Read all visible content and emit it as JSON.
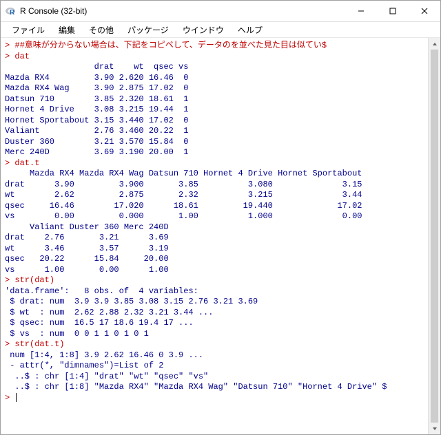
{
  "window": {
    "title": "R Console (32-bit)"
  },
  "menubar": {
    "file": "ファイル",
    "edit": "編集",
    "misc": "その他",
    "packages": "パッケージ",
    "window": "ウインドウ",
    "help": "ヘルプ"
  },
  "console": {
    "line1_prompt": "> ",
    "line1_text": "##意味が分からない場合は、下記をコピペして、データのを並べた見た目は似てい$",
    "line2_prompt": "> ",
    "line2_text": "dat",
    "out_block1": "                  drat    wt  qsec vs\nMazda RX4         3.90 2.620 16.46  0\nMazda RX4 Wag     3.90 2.875 17.02  0\nDatsun 710        3.85 2.320 18.61  1\nHornet 4 Drive    3.08 3.215 19.44  1\nHornet Sportabout 3.15 3.440 17.02  0\nValiant           2.76 3.460 20.22  1\nDuster 360        3.21 3.570 15.84  0\nMerc 240D         3.69 3.190 20.00  1",
    "line3_prompt": "> ",
    "line3_text": "dat.t",
    "out_block2": "     Mazda RX4 Mazda RX4 Wag Datsun 710 Hornet 4 Drive Hornet Sportabout\ndrat      3.90         3.900       3.85          3.080              3.15\nwt        2.62         2.875       2.32          3.215              3.44\nqsec     16.46        17.020      18.61         19.440             17.02\nvs        0.00         0.000       1.00          1.000              0.00\n     Valiant Duster 360 Merc 240D\ndrat    2.76       3.21      3.69\nwt      3.46       3.57      3.19\nqsec   20.22      15.84     20.00\nvs      1.00       0.00      1.00",
    "line4_prompt": "> ",
    "line4_text": "str(dat)",
    "out_block3": "'data.frame':   8 obs. of  4 variables:\n $ drat: num  3.9 3.9 3.85 3.08 3.15 2.76 3.21 3.69\n $ wt  : num  2.62 2.88 2.32 3.21 3.44 ...\n $ qsec: num  16.5 17 18.6 19.4 17 ...\n $ vs  : num  0 0 1 1 0 1 0 1",
    "line5_prompt": "> ",
    "line5_text": "str(dat.t)",
    "out_block4": " num [1:4, 1:8] 3.9 2.62 16.46 0 3.9 ...\n - attr(*, \"dimnames\")=List of 2\n  ..$ : chr [1:4] \"drat\" \"wt\" \"qsec\" \"vs\"\n  ..$ : chr [1:8] \"Mazda RX4\" \"Mazda RX4 Wag\" \"Datsun 710\" \"Hornet 4 Drive\" $",
    "line6_prompt": "> "
  },
  "chart_data": {
    "type": "table",
    "title": "dat",
    "columns": [
      "drat",
      "wt",
      "qsec",
      "vs"
    ],
    "rows": [
      {
        "name": "Mazda RX4",
        "drat": 3.9,
        "wt": 2.62,
        "qsec": 16.46,
        "vs": 0
      },
      {
        "name": "Mazda RX4 Wag",
        "drat": 3.9,
        "wt": 2.875,
        "qsec": 17.02,
        "vs": 0
      },
      {
        "name": "Datsun 710",
        "drat": 3.85,
        "wt": 2.32,
        "qsec": 18.61,
        "vs": 1
      },
      {
        "name": "Hornet 4 Drive",
        "drat": 3.08,
        "wt": 3.215,
        "qsec": 19.44,
        "vs": 1
      },
      {
        "name": "Hornet Sportabout",
        "drat": 3.15,
        "wt": 3.44,
        "qsec": 17.02,
        "vs": 0
      },
      {
        "name": "Valiant",
        "drat": 2.76,
        "wt": 3.46,
        "qsec": 20.22,
        "vs": 1
      },
      {
        "name": "Duster 360",
        "drat": 3.21,
        "wt": 3.57,
        "qsec": 15.84,
        "vs": 0
      },
      {
        "name": "Merc 240D",
        "drat": 3.69,
        "wt": 3.19,
        "qsec": 20.0,
        "vs": 1
      }
    ]
  }
}
